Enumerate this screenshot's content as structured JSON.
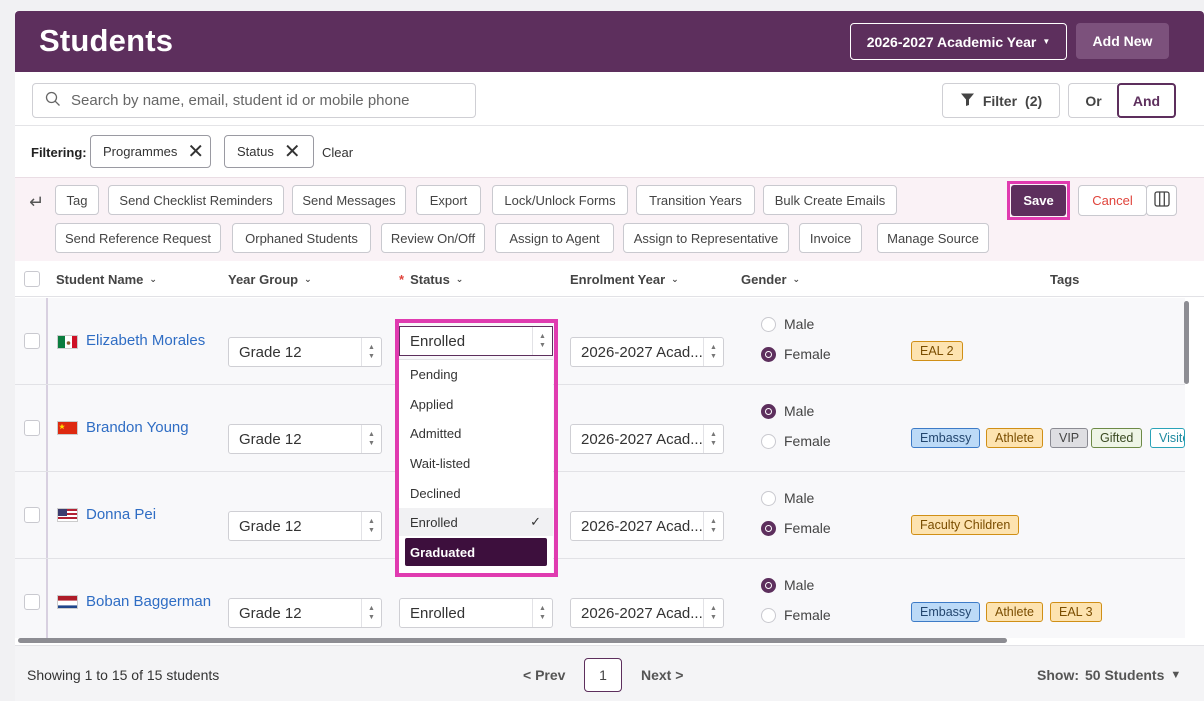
{
  "header": {
    "title": "Students",
    "academic_year": "2026-2027 Academic Year",
    "add_new": "Add New"
  },
  "search": {
    "placeholder": "Search by name, email, student id or mobile phone",
    "value": ""
  },
  "filter": {
    "label": "Filter",
    "count": "(2)",
    "or": "Or",
    "and": "And"
  },
  "filtering": {
    "label": "Filtering:",
    "chips": [
      "Programmes",
      "Status"
    ],
    "clear": "Clear"
  },
  "toolbar": {
    "row1": [
      "Tag",
      "Send Checklist Reminders",
      "Send Messages",
      "Export",
      "Lock/Unlock Forms",
      "Transition Years",
      "Bulk Create Emails"
    ],
    "row2": [
      "Send Reference Request",
      "Orphaned Students",
      "Review On/Off",
      "Assign to Agent",
      "Assign to Representative",
      "Invoice",
      "Manage Source"
    ],
    "save": "Save",
    "cancel": "Cancel"
  },
  "table": {
    "columns": {
      "name": "Student Name",
      "year_group": "Year Group",
      "status_req": "*",
      "status": "Status",
      "enrolment_year": "Enrolment Year",
      "gender": "Gender",
      "tags": "Tags"
    },
    "rows": [
      {
        "name": "Elizabeth Morales",
        "flag": "mexico",
        "year_group": "Grade 12",
        "status": "Enrolled",
        "enrolment_year": "2026-2027 Acad...",
        "male": "Male",
        "female": "Female",
        "gender": "female",
        "tags": [
          "EAL 2"
        ]
      },
      {
        "name": "Brandon Young",
        "flag": "china",
        "year_group": "Grade 12",
        "status": "",
        "enrolment_year": "2026-2027 Acad...",
        "male": "Male",
        "female": "Female",
        "gender": "male",
        "tags": [
          "Embassy",
          "Athlete",
          "VIP",
          "Gifted",
          "Visited"
        ]
      },
      {
        "name": "Donna Pei",
        "flag": "usa",
        "year_group": "Grade 12",
        "status": "",
        "enrolment_year": "2026-2027 Acad...",
        "male": "Male",
        "female": "Female",
        "gender": "female",
        "tags": [
          "Faculty Children"
        ]
      },
      {
        "name": "Boban Baggerman",
        "flag": "netherlands",
        "year_group": "Grade 12",
        "status": "Enrolled",
        "enrolment_year": "2026-2027 Acad...",
        "male": "Male",
        "female": "Female",
        "gender": "male",
        "tags": [
          "Embassy",
          "Athlete",
          "EAL 3"
        ]
      }
    ]
  },
  "status_dropdown": {
    "current": "Enrolled",
    "options": [
      "Pending",
      "Applied",
      "Admitted",
      "Wait-listed",
      "Declined",
      "Enrolled",
      "Graduated"
    ],
    "selected": "Enrolled",
    "hovered": "Graduated"
  },
  "footer": {
    "showing": "Showing 1 to 15 of 15 students",
    "prev": "< Prev",
    "page": "1",
    "next": "Next >",
    "show_label": "Show:",
    "show_value": "50 Students"
  },
  "colors": {
    "brand": "#5d2f5d",
    "highlight": "#e03bb0",
    "link": "#2f6dc4",
    "cancel": "#e0443c"
  }
}
